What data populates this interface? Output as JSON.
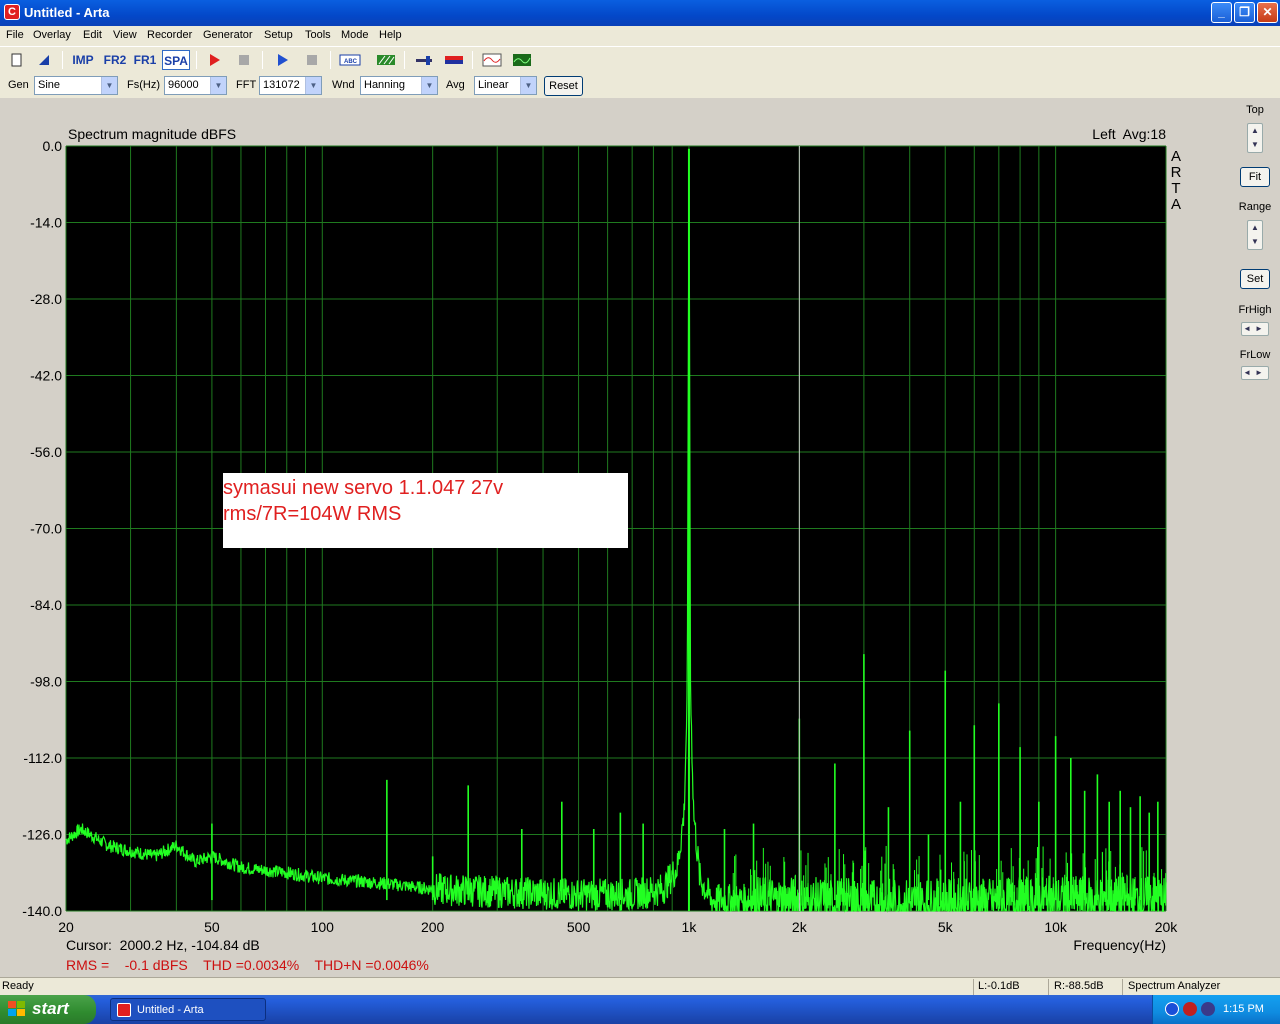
{
  "window": {
    "title": "Untitled - Arta",
    "app_icon": "arta-icon",
    "controls": [
      "minimize-icon",
      "maximize-icon",
      "close-icon"
    ]
  },
  "menu": [
    "File",
    "Overlay",
    "Edit",
    "View",
    "Recorder",
    "Generator",
    "Setup",
    "Tools",
    "Mode",
    "Help"
  ],
  "toolbar": {
    "imp": "IMP",
    "fr2": "FR2",
    "fr1": "FR1",
    "spa": "SPA"
  },
  "controls": {
    "gen_label": "Gen",
    "gen_value": "Sine",
    "fs_label": "Fs(Hz)",
    "fs_value": "96000",
    "fft_label": "FFT",
    "fft_value": "131072",
    "wnd_label": "Wnd",
    "wnd_value": "Hanning",
    "avg_label": "Avg",
    "avg_value": "Linear",
    "reset_label": "Reset"
  },
  "right_panel": {
    "top_label": "Top",
    "fit_label": "Fit",
    "range_label": "Range",
    "set_label": "Set",
    "frhigh_label": "FrHigh",
    "frlow_label": "FrLow"
  },
  "chart_data": {
    "type": "line",
    "title": "Spectrum magnitude dBFS",
    "channel_info": "Left  Avg:18",
    "watermark": [
      "A",
      "R",
      "T",
      "A"
    ],
    "xlabel": "Frequency(Hz)",
    "x_scale": "log",
    "xlim": [
      20,
      20000
    ],
    "ylim": [
      -140,
      0
    ],
    "grid": true,
    "background": "#000000",
    "grid_color": "#1f7a1f",
    "line_color": "#22ff22",
    "x_ticks": [
      {
        "value": 20,
        "label": "20"
      },
      {
        "value": 50,
        "label": "50"
      },
      {
        "value": 100,
        "label": "100"
      },
      {
        "value": 200,
        "label": "200"
      },
      {
        "value": 500,
        "label": "500"
      },
      {
        "value": 1000,
        "label": "1k"
      },
      {
        "value": 2000,
        "label": "2k"
      },
      {
        "value": 5000,
        "label": "5k"
      },
      {
        "value": 10000,
        "label": "10k"
      },
      {
        "value": 20000,
        "label": "20k"
      }
    ],
    "y_ticks": [
      {
        "value": 0,
        "label": "0.0"
      },
      {
        "value": -14,
        "label": "-14.0"
      },
      {
        "value": -28,
        "label": "-28.0"
      },
      {
        "value": -42,
        "label": "-42.0"
      },
      {
        "value": -56,
        "label": "-56.0"
      },
      {
        "value": -70,
        "label": "-70.0"
      },
      {
        "value": -84,
        "label": "-84.0"
      },
      {
        "value": -98,
        "label": "-98.0"
      },
      {
        "value": -112,
        "label": "-112.0"
      },
      {
        "value": -126,
        "label": "-126.0"
      },
      {
        "value": -140,
        "label": "-140.0"
      }
    ],
    "cursor_freq": 2000.2,
    "noise_floor": [
      {
        "x": 20,
        "y": -127
      },
      {
        "x": 22,
        "y": -125
      },
      {
        "x": 26,
        "y": -128
      },
      {
        "x": 30,
        "y": -129
      },
      {
        "x": 35,
        "y": -130
      },
      {
        "x": 40,
        "y": -128
      },
      {
        "x": 45,
        "y": -131
      },
      {
        "x": 50,
        "y": -130
      },
      {
        "x": 60,
        "y": -132
      },
      {
        "x": 80,
        "y": -133
      },
      {
        "x": 100,
        "y": -134
      },
      {
        "x": 150,
        "y": -135
      },
      {
        "x": 200,
        "y": -136
      },
      {
        "x": 300,
        "y": -136.5
      },
      {
        "x": 500,
        "y": -137
      },
      {
        "x": 700,
        "y": -137
      },
      {
        "x": 850,
        "y": -136
      },
      {
        "x": 930,
        "y": -132
      },
      {
        "x": 970,
        "y": -122
      },
      {
        "x": 990,
        "y": -100
      },
      {
        "x": 1000,
        "y": -0.5
      },
      {
        "x": 1010,
        "y": -100
      },
      {
        "x": 1030,
        "y": -122
      },
      {
        "x": 1070,
        "y": -134
      },
      {
        "x": 1150,
        "y": -138
      },
      {
        "x": 1500,
        "y": -138
      },
      {
        "x": 3000,
        "y": -138.5
      },
      {
        "x": 6000,
        "y": -138.5
      },
      {
        "x": 10000,
        "y": -138
      },
      {
        "x": 20000,
        "y": -138
      }
    ],
    "spur_peaks": [
      {
        "x": 50,
        "y": -124
      },
      {
        "x": 150,
        "y": -116
      },
      {
        "x": 200,
        "y": -130
      },
      {
        "x": 250,
        "y": -117
      },
      {
        "x": 350,
        "y": -125
      },
      {
        "x": 450,
        "y": -120
      },
      {
        "x": 550,
        "y": -125
      },
      {
        "x": 650,
        "y": -122
      },
      {
        "x": 750,
        "y": -124
      },
      {
        "x": 1000,
        "y": -49
      },
      {
        "x": 1250,
        "y": -125
      },
      {
        "x": 1500,
        "y": -124
      },
      {
        "x": 2000,
        "y": -104.8
      },
      {
        "x": 2500,
        "y": -113
      },
      {
        "x": 3000,
        "y": -93
      },
      {
        "x": 3500,
        "y": -121
      },
      {
        "x": 4000,
        "y": -107
      },
      {
        "x": 4500,
        "y": -126
      },
      {
        "x": 5000,
        "y": -96
      },
      {
        "x": 5500,
        "y": -120
      },
      {
        "x": 6000,
        "y": -106
      },
      {
        "x": 7000,
        "y": -102
      },
      {
        "x": 8000,
        "y": -110
      },
      {
        "x": 9000,
        "y": -120
      },
      {
        "x": 10000,
        "y": -108
      },
      {
        "x": 11000,
        "y": -112
      },
      {
        "x": 12000,
        "y": -118
      },
      {
        "x": 13000,
        "y": -115
      },
      {
        "x": 14000,
        "y": -120
      },
      {
        "x": 15000,
        "y": -118
      },
      {
        "x": 16000,
        "y": -121
      },
      {
        "x": 17000,
        "y": -119
      },
      {
        "x": 18000,
        "y": -122
      },
      {
        "x": 19000,
        "y": -120
      }
    ],
    "annotation": [
      "symasui new servo 1.1.047 27v",
      "rms/7R=104W RMS"
    ],
    "cursor_text": "Cursor:  2000.2 Hz, -104.84 dB",
    "stats_text": "RMS =    -0.1 dBFS    THD =0.0034%    THD+N =0.0046%"
  },
  "status": {
    "ready": "Ready",
    "level_l": "L:-0.1dB",
    "level_r": "R:-88.5dB",
    "mode": "Spectrum Analyzer"
  },
  "taskbar": {
    "start": "start",
    "task_item": "Untitled - Arta",
    "clock": "1:15 PM"
  }
}
